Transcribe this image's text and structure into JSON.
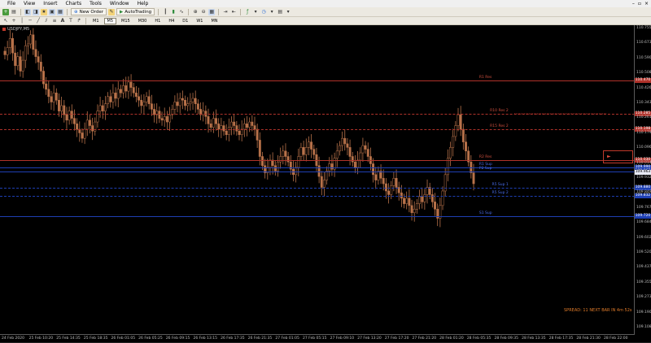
{
  "menu": [
    "File",
    "View",
    "Insert",
    "Charts",
    "Tools",
    "Window",
    "Help"
  ],
  "toolbar": {
    "new_order": "New Order",
    "autotrading": "AutoTrading"
  },
  "timeframes": [
    "M1",
    "M5",
    "M15",
    "M30",
    "H1",
    "H4",
    "D1",
    "W1",
    "MN"
  ],
  "active_timeframe": "M5",
  "symbol": "USDJPY,M5",
  "price_axis": [
    "110.755",
    "110.673",
    "110.590",
    "110.508",
    "110.426",
    "110.343",
    "110.261",
    "110.179",
    "110.096",
    "110.014",
    "109.932",
    "109.849",
    "109.767",
    "109.684",
    "109.602",
    "109.520",
    "109.437",
    "109.355",
    "109.273",
    "109.190",
    "109.108"
  ],
  "time_axis": [
    "24 Feb 2020",
    "25 Feb 10:20",
    "25 Feb 14:35",
    "25 Feb 18:35",
    "26 Feb 01:05",
    "26 Feb 05:25",
    "26 Feb 09:15",
    "26 Feb 13:15",
    "26 Feb 17:35",
    "26 Feb 21:35",
    "27 Feb 01:05",
    "27 Feb 05:15",
    "27 Feb 09:10",
    "27 Feb 13:20",
    "27 Feb 17:20",
    "27 Feb 21:20",
    "28 Feb 01:20",
    "28 Feb 05:35",
    "28 Feb 09:35",
    "28 Feb 13:35",
    "28 Feb 17:35",
    "28 Feb 21:30",
    "28 Feb 22:00"
  ],
  "levels": [
    {
      "label": "R1 Res",
      "price": "110.470",
      "color": "#b0322a",
      "style": "solid",
      "label_pos": 0.755
    },
    {
      "label": "R10 Res 2",
      "price": "110.285",
      "color": "#b0322a",
      "style": "dashed",
      "label_pos": 0.772
    },
    {
      "label": "R15 Res 2",
      "price": "110.198",
      "color": "#b0322a",
      "style": "dashed",
      "label_pos": 0.772
    },
    {
      "label": "R2 Res",
      "price": "110.030",
      "color": "#b0322a",
      "style": "solid",
      "label_pos": 0.755
    },
    {
      "label": "R1 Sup",
      "price": "109.990",
      "color": "#1e3fb3",
      "style": "solid",
      "label_pos": 0.755
    },
    {
      "label": "P2 Sup",
      "price": "109.967",
      "color": "#1e3fb3",
      "style": "solid",
      "label_pos": 0.755
    },
    {
      "label": "R5 Sup 1",
      "price": "109.880",
      "color": "#1e3fb3",
      "style": "dashed",
      "label_pos": 0.775
    },
    {
      "label": "R5 Sup 2",
      "price": "109.832",
      "color": "#1e3fb3",
      "style": "dashed",
      "label_pos": 0.775
    },
    {
      "label": "S1 Sup",
      "price": "109.720",
      "color": "#1e3fb3",
      "style": "solid",
      "label_pos": 0.755
    }
  ],
  "current_price": "109.963",
  "status_text": "SPREAD: 11 NEXT BAR IN 4m 52s",
  "colors": {
    "candle": "#b8724a",
    "resistance": "#b0322a",
    "support": "#1e3fb3",
    "status": "#e07b2a"
  },
  "ohlc": [
    110.61,
    110.65,
    110.7,
    110.62,
    110.55,
    110.6,
    110.52,
    110.58,
    110.66,
    110.67,
    110.72,
    110.64,
    110.6,
    110.57,
    110.52,
    110.45,
    110.42,
    110.38,
    110.35,
    110.4,
    110.36,
    110.3,
    110.33,
    110.28,
    110.25,
    110.3,
    110.26,
    110.23,
    110.2,
    110.18,
    110.15,
    110.2,
    110.25,
    110.22,
    110.19,
    110.24,
    110.3,
    110.33,
    110.3,
    110.34,
    110.38,
    110.35,
    110.4,
    110.37,
    110.42,
    110.4,
    110.44,
    110.41,
    110.46,
    110.43,
    110.4,
    110.38,
    110.36,
    110.33,
    110.35,
    110.38,
    110.34,
    110.31,
    110.28,
    110.3,
    110.26,
    110.25,
    110.27,
    110.24,
    110.28,
    110.31,
    110.35,
    110.33,
    110.37,
    110.36,
    110.33,
    110.34,
    110.35,
    110.37,
    110.34,
    110.31,
    110.28,
    110.3,
    110.27,
    110.23,
    110.21,
    110.26,
    110.23,
    110.2,
    110.22,
    110.19,
    110.17,
    110.21,
    110.24,
    110.22,
    110.19,
    110.17,
    110.2,
    110.23,
    110.21,
    110.24,
    110.22,
    110.2,
    110.14,
    110.05,
    110.0,
    109.96,
    109.99,
    110.03,
    110.0,
    109.97,
    110.02,
    110.05,
    110.08,
    110.05,
    110.02,
    109.98,
    109.95,
    109.99,
    110.05,
    110.1,
    110.06,
    110.1,
    110.13,
    110.09,
    110.06,
    110.0,
    109.94,
    109.88,
    109.92,
    109.97,
    110.01,
    109.98,
    110.04,
    110.08,
    110.11,
    110.15,
    110.12,
    110.1,
    110.05,
    110.02,
    109.99,
    110.03,
    110.07,
    110.11,
    110.09,
    110.05,
    110.01,
    109.95,
    109.92,
    109.97,
    109.93,
    109.9,
    109.86,
    109.84,
    109.89,
    109.93,
    109.88,
    109.85,
    109.82,
    109.79,
    109.82,
    109.78,
    109.74,
    109.76,
    109.79,
    109.83,
    109.8,
    109.84,
    109.88,
    109.84,
    109.8,
    109.76,
    109.71,
    109.78,
    109.86,
    109.95,
    110.04,
    110.1,
    110.16,
    110.22,
    110.28,
    110.2,
    110.13,
    110.08,
    110.02,
    109.96,
    109.9
  ]
}
